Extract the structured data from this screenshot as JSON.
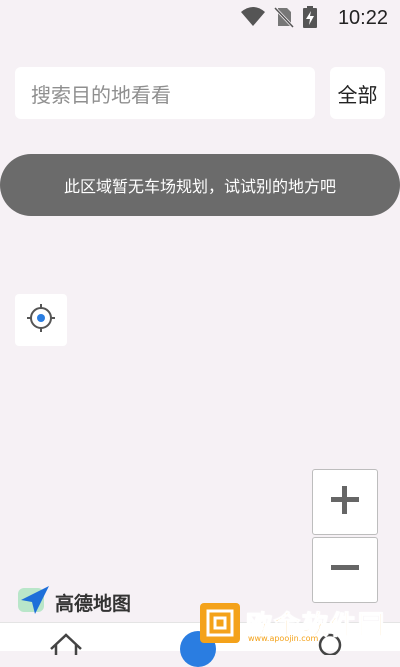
{
  "status_bar": {
    "time": "10:22",
    "icons": [
      "wifi-icon",
      "no-sim-icon",
      "battery-charging-icon"
    ]
  },
  "search": {
    "placeholder": "搜索目的地看看",
    "filter_label": "全部"
  },
  "toast": {
    "message": "此区域暂无车场规划，试试别的地方吧"
  },
  "map_controls": {
    "locate_icon": "locate-icon",
    "zoom_in_icon": "plus-icon",
    "zoom_out_icon": "minus-icon"
  },
  "logo": {
    "text": "高德地图",
    "icon": "amap-arrow-icon"
  },
  "watermark": {
    "text": "欧金软件园",
    "url": "www.apoojin.com"
  },
  "bottom_nav": {
    "icons": [
      "home-icon",
      "center-icon",
      "profile-icon"
    ]
  },
  "colors": {
    "background": "#f6f1f5",
    "toast": "#6b6b6b",
    "accent": "#2a7de1",
    "watermark": "#f4a21a"
  }
}
